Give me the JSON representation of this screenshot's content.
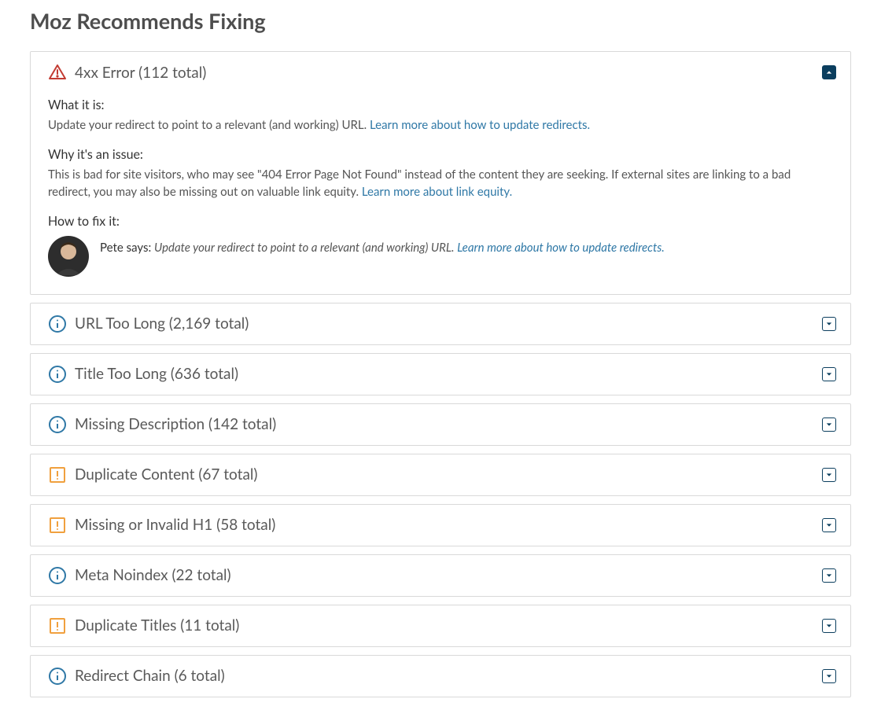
{
  "page": {
    "title": "Moz Recommends Fixing"
  },
  "sections": {
    "what_label": "What it is:",
    "why_label": "Why it's an issue:",
    "fix_label": "How to fix it:",
    "fix_lead": "Pete says:"
  },
  "expanded": {
    "what_text": "Update your redirect to point to a relevant (and working) URL. ",
    "what_link": "Learn more about how to update redirects.",
    "why_text": "This is bad for site visitors, who may see \"404 Error Page Not Found\" instead of the content they are seeking. If external sites are linking to a bad redirect, you may also be missing out on valuable link equity. ",
    "why_link": "Learn more about link equity.",
    "fix_text": "Update your redirect to point to a relevant (and working) URL. ",
    "fix_link": "Learn more about how to update redirects."
  },
  "items": [
    {
      "label": "4xx Error (112 total)",
      "severity": "critical",
      "open": true
    },
    {
      "label": "URL Too Long (2,169 total)",
      "severity": "info",
      "open": false
    },
    {
      "label": "Title Too Long (636 total)",
      "severity": "info",
      "open": false
    },
    {
      "label": "Missing Description (142 total)",
      "severity": "info",
      "open": false
    },
    {
      "label": "Duplicate Content (67 total)",
      "severity": "warning",
      "open": false
    },
    {
      "label": "Missing or Invalid H1 (58 total)",
      "severity": "warning",
      "open": false
    },
    {
      "label": "Meta Noindex (22 total)",
      "severity": "info",
      "open": false
    },
    {
      "label": "Duplicate Titles (11 total)",
      "severity": "warning",
      "open": false
    },
    {
      "label": "Redirect Chain (6 total)",
      "severity": "info",
      "open": false
    }
  ],
  "colors": {
    "critical": "#c33b32",
    "warning": "#f0a03e",
    "info": "#2f78a6"
  }
}
